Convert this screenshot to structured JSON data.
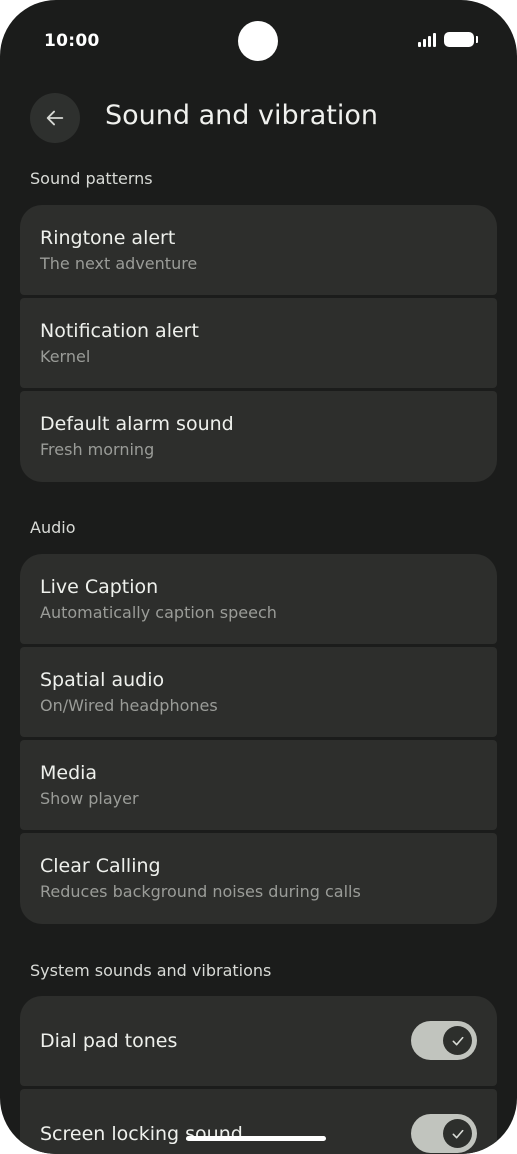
{
  "status_bar": {
    "time": "10:00",
    "icons": [
      "signal-icon",
      "battery-icon"
    ]
  },
  "header": {
    "back_icon": "arrow-left-icon",
    "title": "Sound and vibration"
  },
  "sections": {
    "sound_patterns": {
      "header": "Sound patterns",
      "items": [
        {
          "title": "Ringtone alert",
          "subtitle": "The next adventure"
        },
        {
          "title": "Notification alert",
          "subtitle": "Kernel"
        },
        {
          "title": "Default alarm sound",
          "subtitle": "Fresh morning"
        }
      ]
    },
    "audio": {
      "header": "Audio",
      "items": [
        {
          "title": "Live Caption",
          "subtitle": "Automatically caption speech"
        },
        {
          "title": "Spatial audio",
          "subtitle": "On/Wired headphones"
        },
        {
          "title": "Media",
          "subtitle": "Show player"
        },
        {
          "title": "Clear Calling",
          "subtitle": "Reduces background noises during calls"
        }
      ]
    },
    "system": {
      "header": "System sounds and vibrations",
      "items": [
        {
          "title": "Dial pad tones",
          "toggle_on": true
        },
        {
          "title": "Screen locking sound",
          "toggle_on": true
        }
      ]
    }
  },
  "colors": {
    "background": "#1b1c1b",
    "card": "#2d2e2c",
    "toggle_track": "#c1c4be",
    "toggle_knob": "#2d2f2c"
  }
}
